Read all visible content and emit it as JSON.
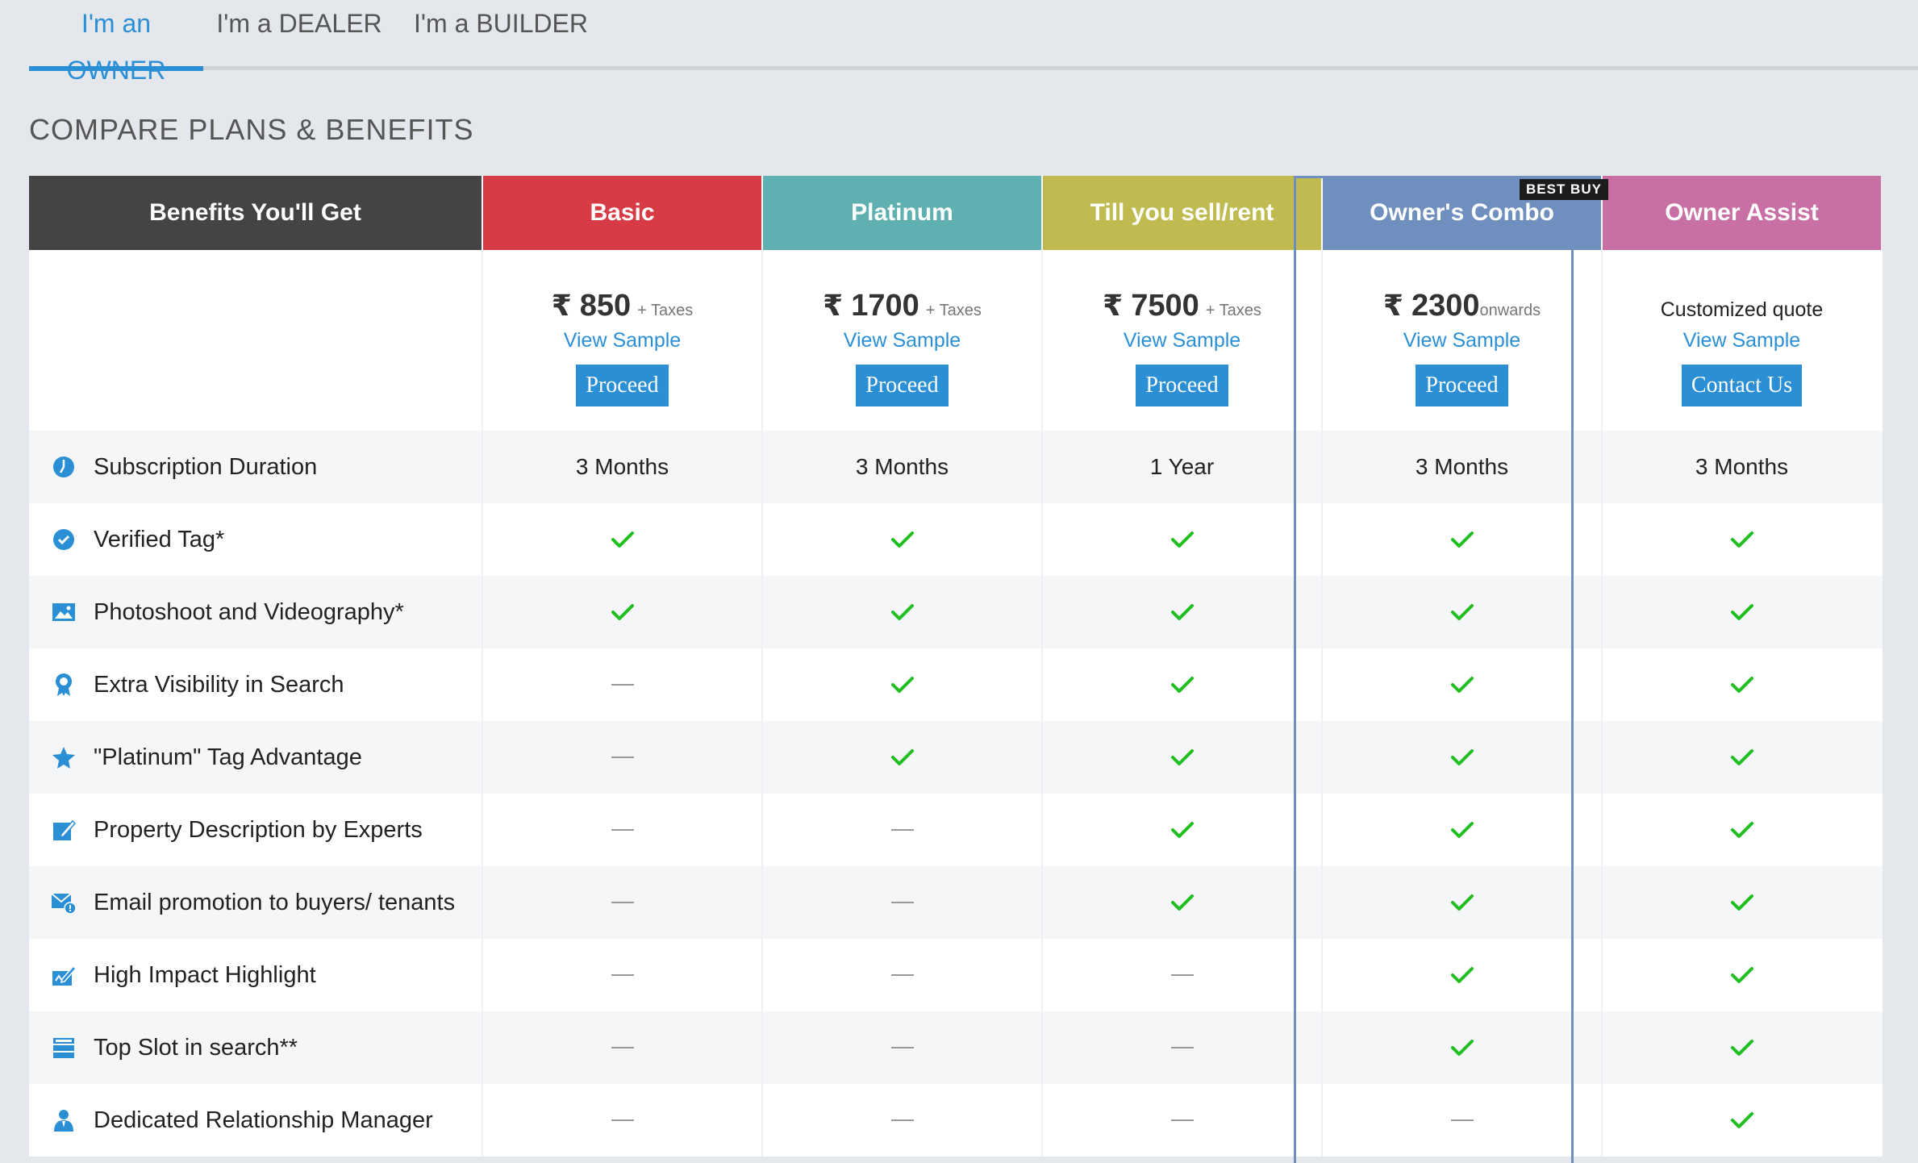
{
  "tabs": [
    {
      "label": "I'm an OWNER",
      "active": true
    },
    {
      "label": "I'm a DEALER",
      "active": false
    },
    {
      "label": "I'm a BUILDER",
      "active": false
    }
  ],
  "section_title": "COMPARE PLANS & BENEFITS",
  "benefits_header": "Benefits You'll Get",
  "best_buy_badge": "BEST BUY",
  "plans": [
    {
      "name": "Basic",
      "color": "#d63b46",
      "currency": "₹",
      "price": "850",
      "suffix": "+ Taxes",
      "sample": "View Sample",
      "action": "Proceed"
    },
    {
      "name": "Platinum",
      "color": "#5fb1b1",
      "currency": "₹",
      "price": "1700",
      "suffix": "+ Taxes",
      "sample": "View Sample",
      "action": "Proceed"
    },
    {
      "name": "Till you sell/rent",
      "color": "#bfbb50",
      "currency": "₹",
      "price": "7500",
      "suffix": "+ Taxes",
      "sample": "View Sample",
      "action": "Proceed"
    },
    {
      "name": "Owner's Combo",
      "color": "#6f8fbf",
      "currency": "₹",
      "price": "2300",
      "suffix": "onwards",
      "sample": "View Sample",
      "action": "Proceed"
    },
    {
      "name": "Owner Assist",
      "color": "#c870a4",
      "quote": "Customized quote",
      "sample": "View Sample",
      "action": "Contact Us"
    }
  ],
  "features": [
    {
      "label": "Subscription Duration",
      "icon": "clock-icon",
      "values": [
        "3 Months",
        "3 Months",
        "1 Year",
        "3 Months",
        "3 Months"
      ]
    },
    {
      "label": "Verified Tag*",
      "icon": "verified-icon",
      "values": [
        "yes",
        "yes",
        "yes",
        "yes",
        "yes"
      ]
    },
    {
      "label": "Photoshoot and Videography*",
      "icon": "photo-icon",
      "values": [
        "yes",
        "yes",
        "yes",
        "yes",
        "yes"
      ]
    },
    {
      "label": "Extra Visibility in Search",
      "icon": "award-icon",
      "values": [
        "no",
        "yes",
        "yes",
        "yes",
        "yes"
      ]
    },
    {
      "label": "\"Platinum\" Tag Advantage",
      "icon": "star-icon",
      "values": [
        "no",
        "yes",
        "yes",
        "yes",
        "yes"
      ]
    },
    {
      "label": "Property Description by Experts",
      "icon": "edit-icon",
      "values": [
        "no",
        "no",
        "yes",
        "yes",
        "yes"
      ]
    },
    {
      "label": "Email promotion to buyers/ tenants",
      "icon": "email-icon",
      "values": [
        "no",
        "no",
        "yes",
        "yes",
        "yes"
      ]
    },
    {
      "label": "High Impact Highlight",
      "icon": "highlight-icon",
      "values": [
        "no",
        "no",
        "no",
        "yes",
        "yes"
      ]
    },
    {
      "label": "Top Slot in search**",
      "icon": "list-icon",
      "values": [
        "no",
        "no",
        "no",
        "yes",
        "yes"
      ]
    },
    {
      "label": "Dedicated Relationship Manager",
      "icon": "user-icon",
      "values": [
        "no",
        "no",
        "no",
        "no",
        "yes"
      ]
    }
  ]
}
